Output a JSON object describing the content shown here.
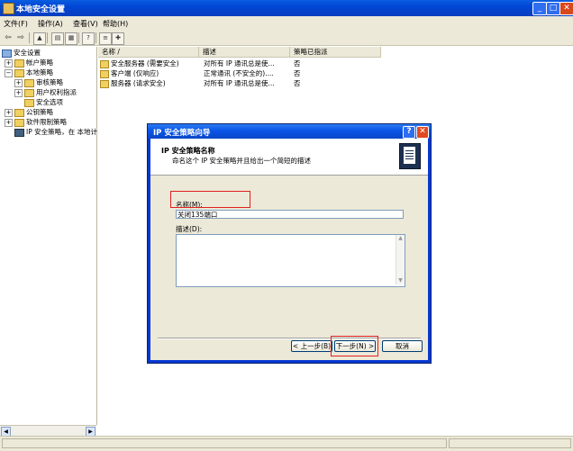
{
  "window": {
    "title": "本地安全设置"
  },
  "menu": [
    "文件(F)",
    "操作(A)",
    "查看(V)",
    "帮助(H)"
  ],
  "toolbar": {
    "icons": [
      "back-arrow-icon",
      "forward-arrow-icon",
      "up-folder-icon",
      "properties-icon",
      "export-list-icon",
      "help-icon",
      "policy-icon",
      "new-policy-icon"
    ]
  },
  "tree": {
    "items": [
      {
        "label": "安全设置"
      },
      {
        "label": "帐户策略"
      },
      {
        "label": "本地策略"
      },
      {
        "label": "审核策略"
      },
      {
        "label": "用户权利指派"
      },
      {
        "label": "安全选项"
      },
      {
        "label": "公钥策略"
      },
      {
        "label": "软件限制策略"
      },
      {
        "label": "IP 安全策略，在 本地计"
      }
    ]
  },
  "list": {
    "headers": [
      "名称 /",
      "描述",
      "策略已指派"
    ],
    "rows": [
      {
        "name": "安全服务器 (需要安全)",
        "desc": "对所有 IP 通讯总是使...",
        "assigned": "否"
      },
      {
        "name": "客户端 (仅响应)",
        "desc": "正常通讯 (不安全的)....",
        "assigned": "否"
      },
      {
        "name": "服务器 (请求安全)",
        "desc": "对所有 IP 通讯总是使...",
        "assigned": "否"
      }
    ]
  },
  "dialog": {
    "title": "IP 安全策略向导",
    "heading": "IP 安全策略名称",
    "subheading": "命名这个 IP 安全策略并且给出一个简短的描述",
    "name_label": "名称(M):",
    "name_value": "关闭135端口",
    "desc_label": "描述(D):",
    "desc_value": "",
    "back_label": "< 上一步(B)",
    "next_label": "下一步(N) >",
    "cancel_label": "取消"
  },
  "colors": {
    "titlebar": "#0a5de0",
    "dialog_title": "#0a55e6",
    "highlight": "#e02020"
  }
}
